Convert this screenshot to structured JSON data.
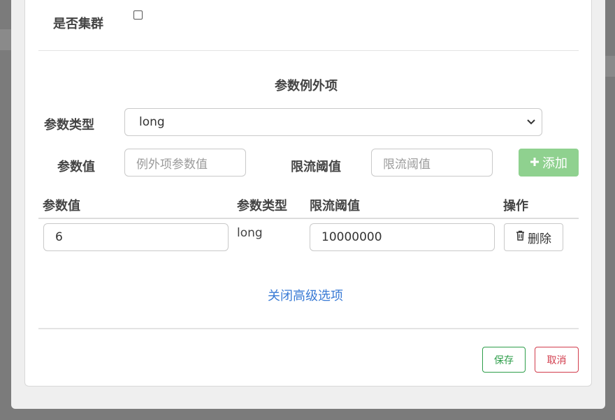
{
  "form": {
    "cluster_label": "是否集群",
    "cluster_checked": false
  },
  "exception_section": {
    "title": "参数例外项",
    "param_type_label": "参数类型",
    "param_type_value": "long",
    "param_value_label": "参数值",
    "param_value_placeholder": "例外项参数值",
    "threshold_label": "限流阈值",
    "threshold_placeholder": "限流阈值",
    "add_button": "添加"
  },
  "table": {
    "headers": [
      "参数值",
      "参数类型",
      "限流阈值",
      "操作"
    ],
    "rows": [
      {
        "param_value": "6",
        "param_type": "long",
        "threshold": "10000000",
        "action": "删除"
      }
    ]
  },
  "advanced_toggle": "关闭高级选项",
  "footer": {
    "save": "保存",
    "cancel": "取消"
  },
  "colors": {
    "add_button": "#8fd18f",
    "link": "#3a7bd5",
    "save": "#2e9e4a",
    "cancel": "#d23c4c"
  }
}
